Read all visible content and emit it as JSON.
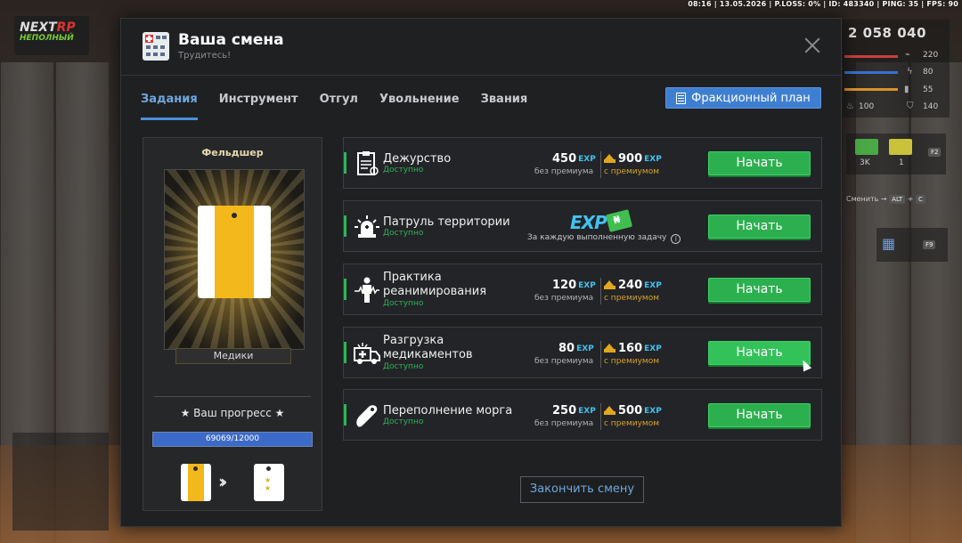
{
  "status_bar": "08:16 | 13.05.2026 | P.LOSS: 0% | ID: 483340 | PING: 35 | FPS: 90",
  "logo": {
    "line1a": "NEXT",
    "line1b": "RP",
    "line2": "НЕПОЛНЫЙ"
  },
  "hud": {
    "money": "2 058 040",
    "stats": [
      "220",
      "80",
      "55",
      "100",
      "140"
    ],
    "cards": [
      "3K",
      "1"
    ],
    "card_key": "F2",
    "switch_label": "Сменить",
    "switch_keys": [
      "ALT",
      "C"
    ],
    "calendar_key": "F9"
  },
  "modal": {
    "title": "Ваша смена",
    "subtitle": "Трудитесь!",
    "tabs": [
      "Задания",
      "Инструмент",
      "Отгул",
      "Увольнение",
      "Звания"
    ],
    "active_tab": "Задания",
    "plan_button": "Фракционный план",
    "finish_button": "Закончить смену"
  },
  "rank": {
    "title": "Фельдшер",
    "faction": "Медики",
    "progress_title": "Ваш прогресс",
    "progress_text": "69069/12000",
    "progress_fraction": 1.0
  },
  "tasks": [
    {
      "name": "Дежурство",
      "status": "Доступно",
      "base": "450",
      "premium": "900",
      "base_label": "без премиума",
      "premium_label": "с премиумом",
      "button": "Начать",
      "icon": "clipboard-icon"
    },
    {
      "name": "Патруль территории",
      "status": "Доступно",
      "exp_label": "EXP",
      "note": "За каждую выполненную задачу",
      "button": "Начать",
      "icon": "siren-icon"
    },
    {
      "name": "Практика реанимирования",
      "status": "Доступно",
      "base": "120",
      "premium": "240",
      "base_label": "без премиума",
      "premium_label": "с премиумом",
      "button": "Начать",
      "icon": "heartbeat-person-icon"
    },
    {
      "name": "Разгрузка медикаментов",
      "status": "Доступно",
      "base": "80",
      "premium": "160",
      "base_label": "без премиума",
      "premium_label": "с премиумом",
      "button": "Начать",
      "icon": "ambulance-icon"
    },
    {
      "name": "Переполнение морга",
      "status": "Доступно",
      "base": "250",
      "premium": "500",
      "base_label": "без премиума",
      "premium_label": "с премиумом",
      "button": "Начать",
      "icon": "body-bag-icon"
    }
  ],
  "exp_suffix": "EXP",
  "colors": {
    "accent_green": "#2cb04f",
    "accent_blue": "#3f7fd1",
    "exp_blue": "#41c2f0",
    "gold": "#e0a820"
  }
}
